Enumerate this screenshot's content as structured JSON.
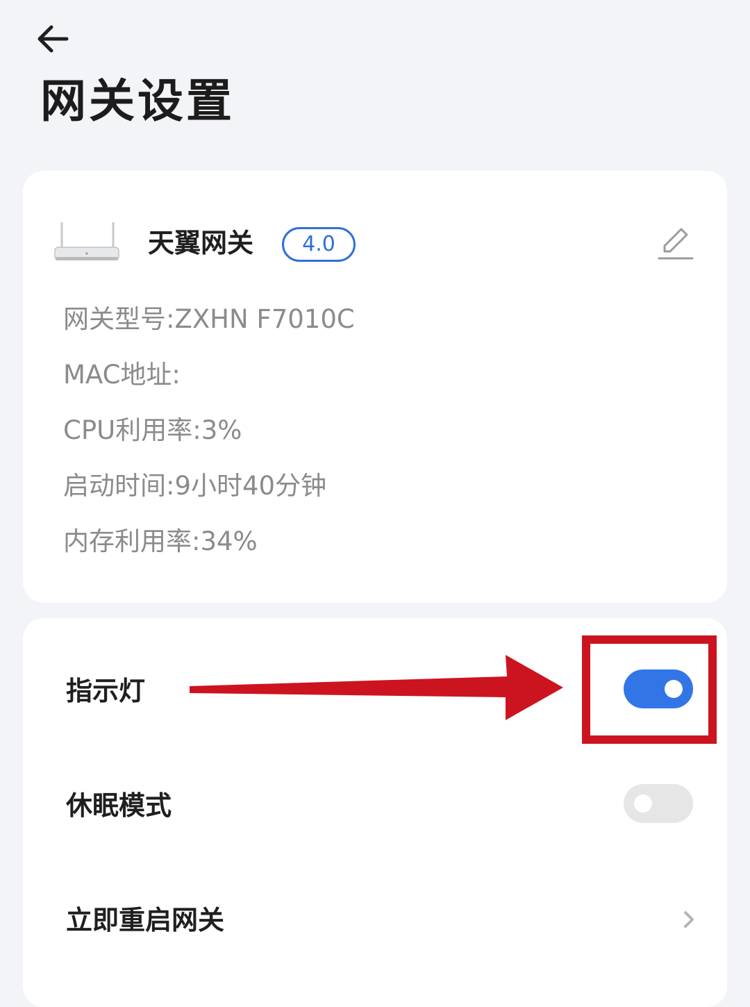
{
  "header": {
    "back_icon": "arrow-left-icon",
    "title": "网关设置"
  },
  "device_card": {
    "image": "router-image",
    "name": "天翼网关",
    "version_badge": "4.0",
    "edit_icon": "pencil-icon",
    "info": [
      {
        "label": "网关型号:",
        "value": "ZXHN F7010C"
      },
      {
        "label": "MAC地址:",
        "value": ""
      },
      {
        "label": "CPU利用率:",
        "value": "3%"
      },
      {
        "label": "启动时间:",
        "value": "9小时40分钟"
      },
      {
        "label": "内存利用率:",
        "value": "34%"
      }
    ]
  },
  "settings": {
    "items": [
      {
        "label": "指示灯",
        "control": "toggle",
        "state": "on"
      },
      {
        "label": "休眠模式",
        "control": "toggle",
        "state": "off"
      },
      {
        "label": "立即重启网关",
        "control": "chevron",
        "icon": "chevron-right-icon"
      }
    ]
  },
  "colors": {
    "background": "#f3f4f8",
    "card": "#ffffff",
    "accent": "#3275e6",
    "badge": "#2f6fdb",
    "toggle_off": "#e6e6e6",
    "annotation_red": "#cc1420",
    "secondary_text": "#8b8b8b"
  },
  "annotation": {
    "arrow": "red-arrow-annotation",
    "highlight": "red-highlight-box",
    "target": "指示灯"
  }
}
